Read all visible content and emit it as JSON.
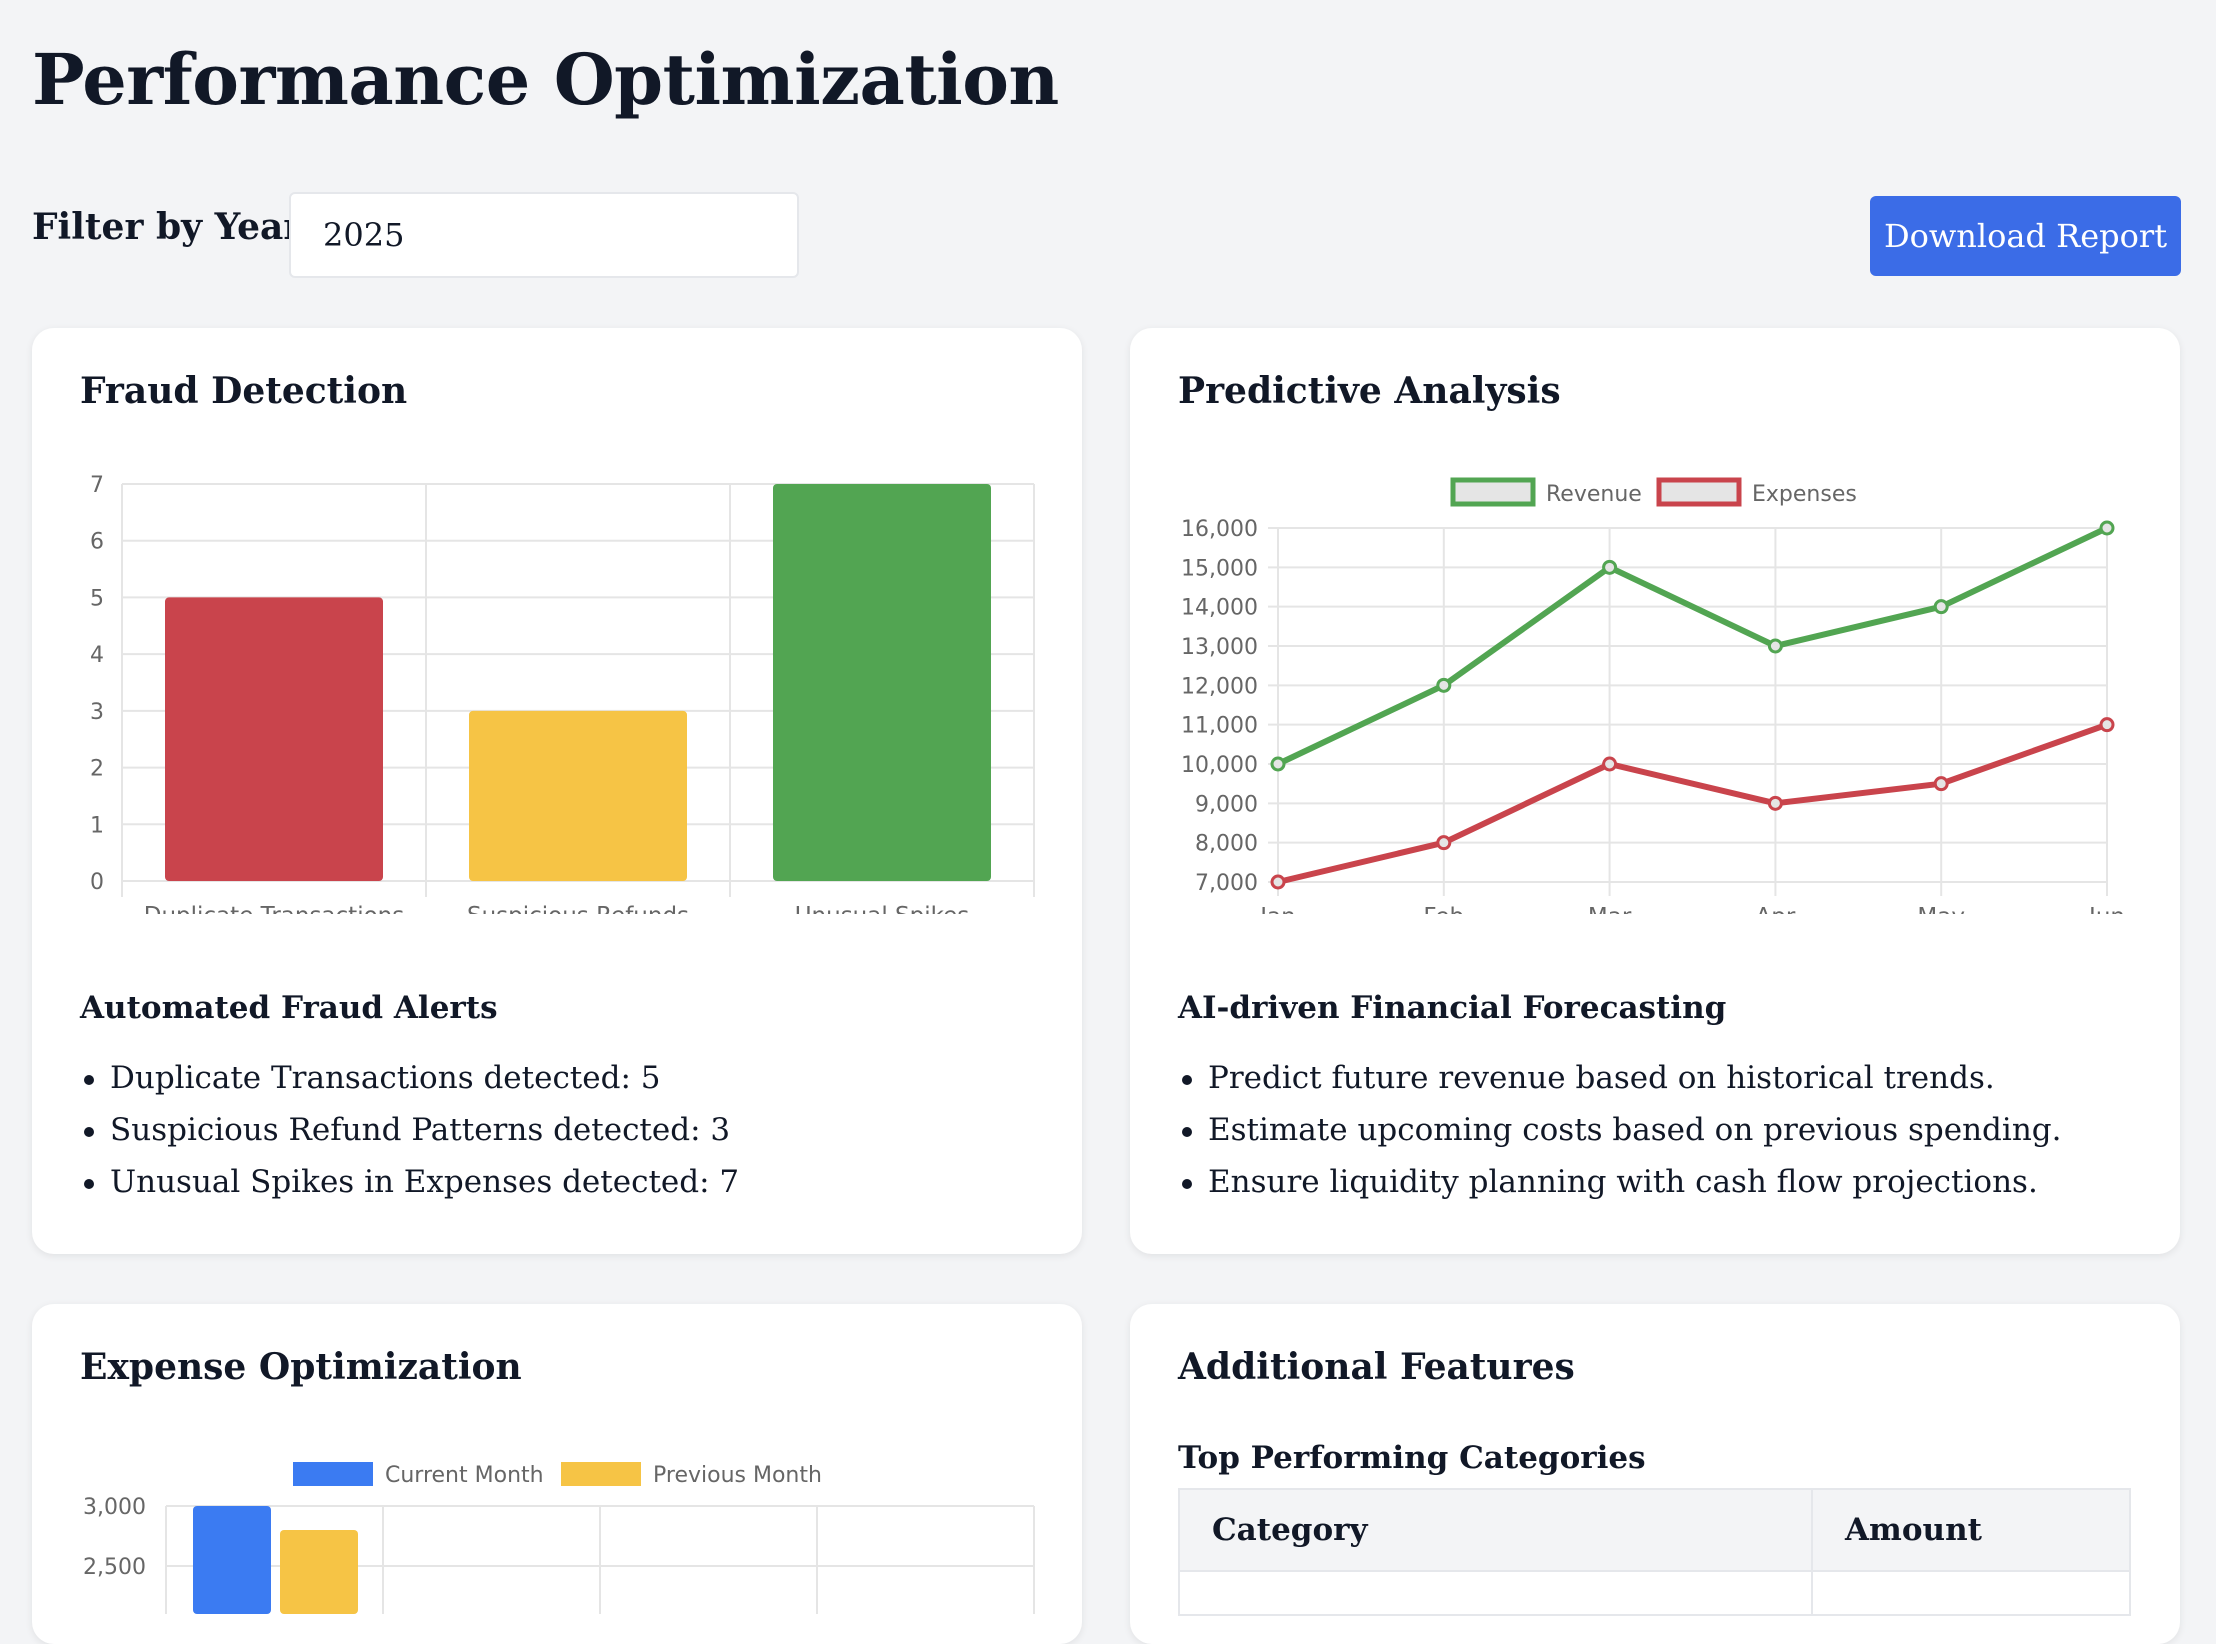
{
  "page": {
    "title": "Performance Optimization"
  },
  "filter": {
    "label": "Filter by Year:",
    "value": "2025"
  },
  "actions": {
    "download_label": "Download Report"
  },
  "colors": {
    "red": "#c9444c",
    "yellow": "#f6c445",
    "green": "#52a552",
    "blue": "#3b7bf2",
    "button": "#3b6ce7"
  },
  "fraud": {
    "title": "Fraud Detection",
    "alerts_title": "Automated Fraud Alerts",
    "alerts": [
      "Duplicate Transactions detected: 5",
      "Suspicious Refund Patterns detected: 3",
      "Unusual Spikes in Expenses detected: 7"
    ]
  },
  "predictive": {
    "title": "Predictive Analysis",
    "sub_title": "AI-driven Financial Forecasting",
    "points": [
      "Predict future revenue based on historical trends.",
      "Estimate upcoming costs based on previous spending.",
      "Ensure liquidity planning with cash flow projections."
    ]
  },
  "expense": {
    "title": "Expense Optimization"
  },
  "features": {
    "title": "Additional Features",
    "table_title": "Top Performing Categories",
    "columns": [
      "Category",
      "Amount"
    ]
  },
  "chart_data": [
    {
      "type": "bar",
      "categories": [
        "Duplicate Transactions",
        "Suspicious Refunds",
        "Unusual Spikes"
      ],
      "values": [
        5,
        3,
        7
      ],
      "colors": [
        "#c9444c",
        "#f6c445",
        "#52a552"
      ],
      "ylim": [
        0,
        7
      ],
      "yticks": [
        "0",
        "1",
        "2",
        "3",
        "4",
        "5",
        "6",
        "7"
      ],
      "grid": true
    },
    {
      "type": "line",
      "x": [
        "Jan",
        "Feb",
        "Mar",
        "Apr",
        "May",
        "Jun"
      ],
      "series": [
        {
          "name": "Revenue",
          "values": [
            10000,
            12000,
            15000,
            13000,
            14000,
            16000
          ],
          "color": "#52a552"
        },
        {
          "name": "Expenses",
          "values": [
            7000,
            8000,
            10000,
            9000,
            9500,
            11000
          ],
          "color": "#c9444c"
        }
      ],
      "ylim": [
        7000,
        16000
      ],
      "yticks": [
        "7,000",
        "8,000",
        "9,000",
        "10,000",
        "11,000",
        "12,000",
        "13,000",
        "14,000",
        "15,000",
        "16,000"
      ],
      "legend": "top",
      "grid": true
    },
    {
      "type": "bar",
      "series": [
        {
          "name": "Current Month",
          "values": [
            3000
          ],
          "color": "#3b7bf2"
        },
        {
          "name": "Previous Month",
          "values": [
            2800
          ],
          "color": "#f6c445"
        }
      ],
      "yticks": [
        "3,000",
        "2,500"
      ],
      "legend": "top",
      "grid": true
    }
  ]
}
